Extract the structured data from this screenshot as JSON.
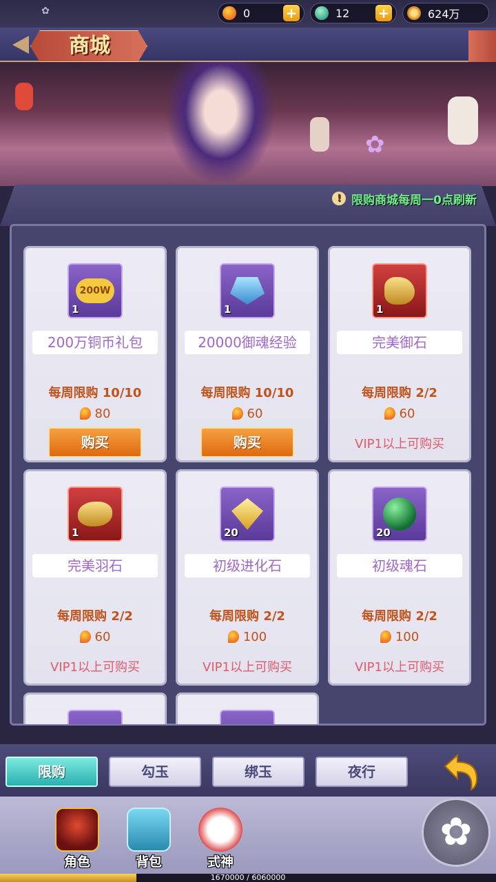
{
  "top_bar": {
    "magatama": {
      "value": "0",
      "icon": "magatama-icon"
    },
    "jade": {
      "value": "12",
      "icon": "jade-icon"
    },
    "coins": {
      "value": "624万",
      "icon": "coin-icon"
    }
  },
  "header": {
    "title": "商城"
  },
  "notice": "限购商城每周一0点刷新",
  "items": [
    {
      "name": "200万铜币礼包",
      "icon_text": "200W",
      "qty": "1",
      "limit": "每周限购  10/10",
      "price": "80",
      "action": "购买"
    },
    {
      "name": "20000御魂经验",
      "qty": "1",
      "limit": "每周限购  10/10",
      "price": "60",
      "action": "购买"
    },
    {
      "name": "完美御石",
      "qty": "1",
      "limit": "每周限购  2/2",
      "price": "60",
      "vip": "VIP1以上可购买"
    },
    {
      "name": "完美羽石",
      "qty": "1",
      "limit": "每周限购  2/2",
      "price": "60",
      "vip": "VIP1以上可购买"
    },
    {
      "name": "初级进化石",
      "qty": "20",
      "limit": "每周限购  2/2",
      "price": "100",
      "vip": "VIP1以上可购买"
    },
    {
      "name": "初级魂石",
      "qty": "20",
      "limit": "每周限购  2/2",
      "price": "100",
      "vip": "VIP1以上可购买"
    }
  ],
  "tabs": [
    "限购",
    "勾玉",
    "绑玉",
    "夜行"
  ],
  "bottom_nav": [
    "角色",
    "背包",
    "式神"
  ],
  "exp": {
    "text": "1670000 / 6060000",
    "progress": 0.2756
  },
  "colors": {
    "accent": "#2ab0b0",
    "price": "#c0521a",
    "vip": "#e05a6a",
    "notice": "#6ff08a"
  }
}
